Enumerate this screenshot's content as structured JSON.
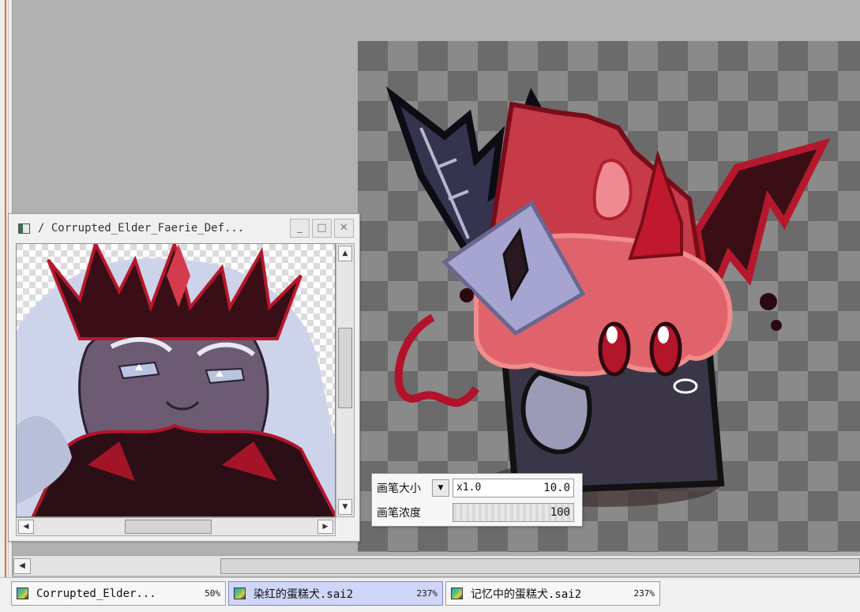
{
  "navigator": {
    "title": "/ Corrupted_Elder_Faerie_Def...",
    "minimize_label": "_",
    "maximize_label": "□",
    "close_label": "✕"
  },
  "brush_panel": {
    "size_label": "画笔大小",
    "size_multiplier": "x1.0",
    "size_value": "10.0",
    "density_label": "画笔浓度",
    "density_value": "100"
  },
  "documents": [
    {
      "name": "Corrupted_Elder...",
      "zoom": "50%",
      "active": false
    },
    {
      "name": "染红的蛋糕犬.sai2",
      "zoom": "237%",
      "active": true
    },
    {
      "name": "记忆中的蛋糕犬.sai2",
      "zoom": "237%",
      "active": false
    }
  ],
  "colors": {
    "accent_tab": "#cfd6f7",
    "canvas_check_dark": "#6b6b6b",
    "canvas_check_light": "#8a8a8a",
    "workspace": "#b1b1b1"
  },
  "icons": {
    "scroll_left": "◀",
    "scroll_right": "▶",
    "scroll_up": "▲",
    "scroll_down": "▼",
    "dropdown": "▼"
  }
}
